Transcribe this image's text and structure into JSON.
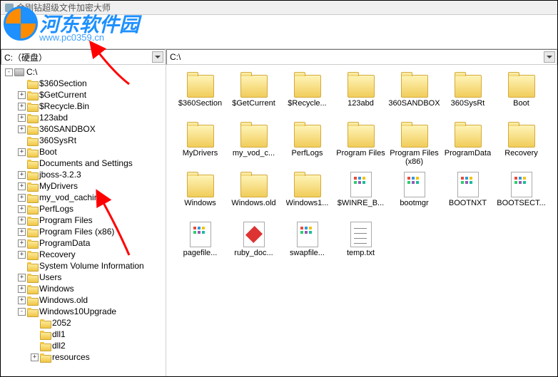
{
  "window": {
    "title": "金刚钻超级文件加密大师"
  },
  "watermark": {
    "text": "河东软件园",
    "url": "www.pc0359.cn"
  },
  "left_combo": "C:（硬盘）",
  "right_path": "C:\\",
  "tree": [
    {
      "level": 0,
      "icon": "drive",
      "label": "C:\\",
      "exp": "-"
    },
    {
      "level": 1,
      "icon": "folder",
      "label": "$360Section",
      "exp": ""
    },
    {
      "level": 1,
      "icon": "folder",
      "label": "$GetCurrent",
      "exp": "+"
    },
    {
      "level": 1,
      "icon": "folder",
      "label": "$Recycle.Bin",
      "exp": "+"
    },
    {
      "level": 1,
      "icon": "folder",
      "label": "123abd",
      "exp": "+"
    },
    {
      "level": 1,
      "icon": "folder",
      "label": "360SANDBOX",
      "exp": "+"
    },
    {
      "level": 1,
      "icon": "folder",
      "label": "360SysRt",
      "exp": ""
    },
    {
      "level": 1,
      "icon": "folder",
      "label": "Boot",
      "exp": "+"
    },
    {
      "level": 1,
      "icon": "folder",
      "label": "Documents and Settings",
      "exp": ""
    },
    {
      "level": 1,
      "icon": "folder",
      "label": "jboss-3.2.3",
      "exp": "+"
    },
    {
      "level": 1,
      "icon": "folder",
      "label": "MyDrivers",
      "exp": "+"
    },
    {
      "level": 1,
      "icon": "folder",
      "label": "my_vod_caching",
      "exp": "+"
    },
    {
      "level": 1,
      "icon": "folder",
      "label": "PerfLogs",
      "exp": "+"
    },
    {
      "level": 1,
      "icon": "folder",
      "label": "Program Files",
      "exp": "+"
    },
    {
      "level": 1,
      "icon": "folder",
      "label": "Program Files (x86)",
      "exp": "+"
    },
    {
      "level": 1,
      "icon": "folder",
      "label": "ProgramData",
      "exp": "+"
    },
    {
      "level": 1,
      "icon": "folder",
      "label": "Recovery",
      "exp": "+"
    },
    {
      "level": 1,
      "icon": "folder",
      "label": "System Volume Information",
      "exp": ""
    },
    {
      "level": 1,
      "icon": "folder",
      "label": "Users",
      "exp": "+"
    },
    {
      "level": 1,
      "icon": "folder",
      "label": "Windows",
      "exp": "+"
    },
    {
      "level": 1,
      "icon": "folder",
      "label": "Windows.old",
      "exp": "+"
    },
    {
      "level": 1,
      "icon": "folder",
      "label": "Windows10Upgrade",
      "exp": "-"
    },
    {
      "level": 2,
      "icon": "folder",
      "label": "2052",
      "exp": ""
    },
    {
      "level": 2,
      "icon": "folder",
      "label": "dll1",
      "exp": ""
    },
    {
      "level": 2,
      "icon": "folder",
      "label": "dll2",
      "exp": ""
    },
    {
      "level": 2,
      "icon": "folder",
      "label": "resources",
      "exp": "+"
    }
  ],
  "grid": [
    {
      "type": "folder",
      "label": "$360Section"
    },
    {
      "type": "folder",
      "label": "$GetCurrent"
    },
    {
      "type": "folder",
      "label": "$Recycle..."
    },
    {
      "type": "folder",
      "label": "123abd"
    },
    {
      "type": "folder",
      "label": "360SANDBOX"
    },
    {
      "type": "folder",
      "label": "360SysRt"
    },
    {
      "type": "folder",
      "label": "Boot"
    },
    {
      "type": "folder",
      "label": "MyDrivers"
    },
    {
      "type": "folder",
      "label": "my_vod_c..."
    },
    {
      "type": "folder",
      "label": "PerfLogs"
    },
    {
      "type": "folder",
      "label": "Program Files"
    },
    {
      "type": "folder",
      "label": "Program Files (x86)"
    },
    {
      "type": "folder",
      "label": "ProgramData"
    },
    {
      "type": "folder",
      "label": "Recovery"
    },
    {
      "type": "folder",
      "label": "Windows"
    },
    {
      "type": "folder",
      "label": "Windows.old"
    },
    {
      "type": "folder",
      "label": "Windows1..."
    },
    {
      "type": "file",
      "label": "$WINRE_B...",
      "variant": "img"
    },
    {
      "type": "file",
      "label": "bootmgr",
      "variant": "img"
    },
    {
      "type": "file",
      "label": "BOOTNXT",
      "variant": "img"
    },
    {
      "type": "file",
      "label": "BOOTSECT...",
      "variant": "img"
    },
    {
      "type": "file",
      "label": "pagefile...",
      "variant": "img"
    },
    {
      "type": "file",
      "label": "ruby_doc...",
      "variant": "ruby"
    },
    {
      "type": "file",
      "label": "swapfile...",
      "variant": "img"
    },
    {
      "type": "file",
      "label": "temp.txt",
      "variant": "txt"
    }
  ]
}
